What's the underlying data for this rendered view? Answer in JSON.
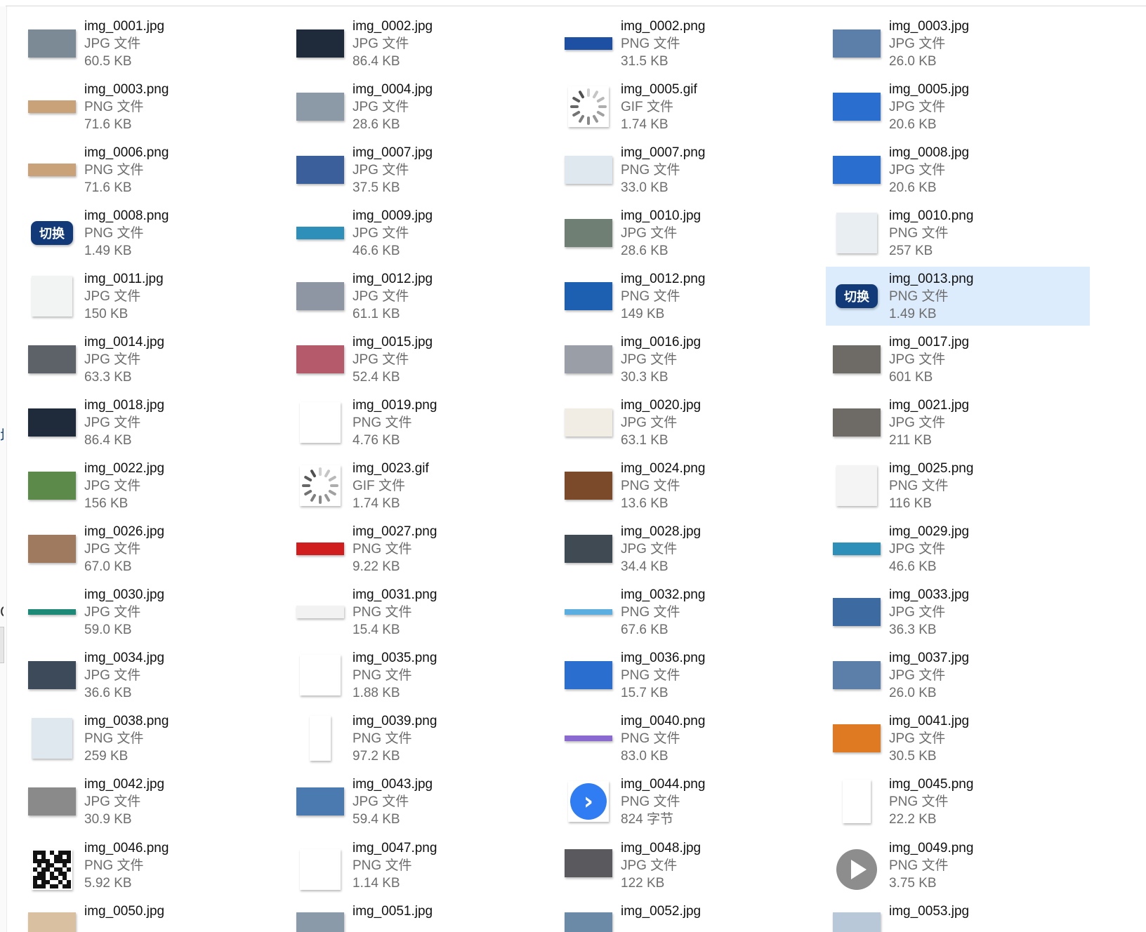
{
  "files": [
    {
      "name": "img_0001.jpg",
      "type": "JPG 文件",
      "size": "60.5 KB",
      "thumb": {
        "kind": "photo",
        "bg": "#7c8a96"
      }
    },
    {
      "name": "img_0002.jpg",
      "type": "JPG 文件",
      "size": "86.4 KB",
      "thumb": {
        "kind": "photo",
        "bg": "#1f2a3a"
      }
    },
    {
      "name": "img_0002.png",
      "type": "PNG 文件",
      "size": "31.5 KB",
      "thumb": {
        "kind": "banner",
        "bg": "#1d4fa3"
      }
    },
    {
      "name": "img_0003.jpg",
      "type": "JPG 文件",
      "size": "26.0 KB",
      "thumb": {
        "kind": "photo",
        "bg": "#5b7fa8"
      }
    },
    {
      "name": "img_0003.png",
      "type": "PNG 文件",
      "size": "71.6 KB",
      "thumb": {
        "kind": "banner",
        "bg": "#c9a27a"
      }
    },
    {
      "name": "img_0004.jpg",
      "type": "JPG 文件",
      "size": "28.6 KB",
      "thumb": {
        "kind": "photo",
        "bg": "#8c9aa8"
      }
    },
    {
      "name": "img_0005.gif",
      "type": "GIF 文件",
      "size": "1.74 KB",
      "thumb": {
        "kind": "spinner",
        "bg": "#ffffff"
      }
    },
    {
      "name": "img_0005.jpg",
      "type": "JPG 文件",
      "size": "20.6 KB",
      "thumb": {
        "kind": "photo",
        "bg": "#2a6fd0"
      }
    },
    {
      "name": "img_0006.png",
      "type": "PNG 文件",
      "size": "71.6 KB",
      "thumb": {
        "kind": "banner",
        "bg": "#c9a27a"
      }
    },
    {
      "name": "img_0007.jpg",
      "type": "JPG 文件",
      "size": "37.5 KB",
      "thumb": {
        "kind": "photo",
        "bg": "#3b5f9a"
      }
    },
    {
      "name": "img_0007.png",
      "type": "PNG 文件",
      "size": "33.0 KB",
      "thumb": {
        "kind": "photo",
        "bg": "#dfe8ef"
      }
    },
    {
      "name": "img_0008.jpg",
      "type": "JPG 文件",
      "size": "20.6 KB",
      "thumb": {
        "kind": "photo",
        "bg": "#2a6fd0"
      }
    },
    {
      "name": "img_0008.png",
      "type": "PNG 文件",
      "size": "1.49 KB",
      "thumb": {
        "kind": "badge",
        "bg": "#123a78",
        "text": "切换"
      }
    },
    {
      "name": "img_0009.jpg",
      "type": "JPG 文件",
      "size": "46.6 KB",
      "thumb": {
        "kind": "banner",
        "bg": "#2e8fb8"
      }
    },
    {
      "name": "img_0010.jpg",
      "type": "JPG 文件",
      "size": "28.6 KB",
      "thumb": {
        "kind": "photo",
        "bg": "#6f7f73"
      }
    },
    {
      "name": "img_0010.png",
      "type": "PNG 文件",
      "size": "257 KB",
      "thumb": {
        "kind": "square",
        "bg": "#e9eef3"
      }
    },
    {
      "name": "img_0011.jpg",
      "type": "JPG 文件",
      "size": "150 KB",
      "thumb": {
        "kind": "square",
        "bg": "#f1f4f2"
      }
    },
    {
      "name": "img_0012.jpg",
      "type": "JPG 文件",
      "size": "61.1 KB",
      "thumb": {
        "kind": "photo",
        "bg": "#8e96a4"
      }
    },
    {
      "name": "img_0012.png",
      "type": "PNG 文件",
      "size": "149 KB",
      "thumb": {
        "kind": "photo",
        "bg": "#1d5fb0"
      }
    },
    {
      "name": "img_0013.png",
      "type": "PNG 文件",
      "size": "1.49 KB",
      "thumb": {
        "kind": "badge",
        "bg": "#123a78",
        "text": "切换"
      },
      "selected": true
    },
    {
      "name": "img_0014.jpg",
      "type": "JPG 文件",
      "size": "63.3 KB",
      "thumb": {
        "kind": "photo",
        "bg": "#5d6268"
      }
    },
    {
      "name": "img_0015.jpg",
      "type": "JPG 文件",
      "size": "52.4 KB",
      "thumb": {
        "kind": "photo",
        "bg": "#b45a6a"
      }
    },
    {
      "name": "img_0016.jpg",
      "type": "JPG 文件",
      "size": "30.3 KB",
      "thumb": {
        "kind": "photo",
        "bg": "#9a9ea6"
      }
    },
    {
      "name": "img_0017.jpg",
      "type": "JPG 文件",
      "size": "601 KB",
      "thumb": {
        "kind": "photo",
        "bg": "#6e6a66"
      }
    },
    {
      "name": "img_0018.jpg",
      "type": "JPG 文件",
      "size": "86.4 KB",
      "thumb": {
        "kind": "photo",
        "bg": "#1f2a3a"
      }
    },
    {
      "name": "img_0019.png",
      "type": "PNG 文件",
      "size": "4.76 KB",
      "thumb": {
        "kind": "square",
        "bg": "#ffffff"
      }
    },
    {
      "name": "img_0020.jpg",
      "type": "JPG 文件",
      "size": "63.1 KB",
      "thumb": {
        "kind": "photo",
        "bg": "#f1ece4"
      }
    },
    {
      "name": "img_0021.jpg",
      "type": "JPG 文件",
      "size": "211 KB",
      "thumb": {
        "kind": "photo",
        "bg": "#6e6a66"
      }
    },
    {
      "name": "img_0022.jpg",
      "type": "JPG 文件",
      "size": "156 KB",
      "thumb": {
        "kind": "photo",
        "bg": "#5c8a4a"
      }
    },
    {
      "name": "img_0023.gif",
      "type": "GIF 文件",
      "size": "1.74 KB",
      "thumb": {
        "kind": "spinner",
        "bg": "#ffffff"
      }
    },
    {
      "name": "img_0024.png",
      "type": "PNG 文件",
      "size": "13.6 KB",
      "thumb": {
        "kind": "photo",
        "bg": "#7a4a2a"
      }
    },
    {
      "name": "img_0025.png",
      "type": "PNG 文件",
      "size": "116 KB",
      "thumb": {
        "kind": "square",
        "bg": "#f4f4f4"
      }
    },
    {
      "name": "img_0026.jpg",
      "type": "JPG 文件",
      "size": "67.0 KB",
      "thumb": {
        "kind": "photo",
        "bg": "#a07a5e"
      }
    },
    {
      "name": "img_0027.png",
      "type": "PNG 文件",
      "size": "9.22 KB",
      "thumb": {
        "kind": "banner",
        "bg": "#d01e1e"
      }
    },
    {
      "name": "img_0028.jpg",
      "type": "JPG 文件",
      "size": "34.4 KB",
      "thumb": {
        "kind": "photo",
        "bg": "#3f4a52"
      }
    },
    {
      "name": "img_0029.jpg",
      "type": "JPG 文件",
      "size": "46.6 KB",
      "thumb": {
        "kind": "banner",
        "bg": "#2e8fb8"
      }
    },
    {
      "name": "img_0030.jpg",
      "type": "JPG 文件",
      "size": "59.0 KB",
      "thumb": {
        "kind": "thin",
        "bg": "#1d8a78"
      }
    },
    {
      "name": "img_0031.png",
      "type": "PNG 文件",
      "size": "15.4 KB",
      "thumb": {
        "kind": "banner",
        "bg": "#f2f2f2"
      }
    },
    {
      "name": "img_0032.png",
      "type": "PNG 文件",
      "size": "67.6 KB",
      "thumb": {
        "kind": "thin",
        "bg": "#5aaee0"
      }
    },
    {
      "name": "img_0033.jpg",
      "type": "JPG 文件",
      "size": "36.3 KB",
      "thumb": {
        "kind": "photo",
        "bg": "#3e6aa2"
      }
    },
    {
      "name": "img_0034.jpg",
      "type": "JPG 文件",
      "size": "36.6 KB",
      "thumb": {
        "kind": "photo",
        "bg": "#3d4a5a"
      }
    },
    {
      "name": "img_0035.png",
      "type": "PNG 文件",
      "size": "1.88 KB",
      "thumb": {
        "kind": "square",
        "bg": "#ffffff"
      }
    },
    {
      "name": "img_0036.png",
      "type": "PNG 文件",
      "size": "15.7 KB",
      "thumb": {
        "kind": "photo",
        "bg": "#2a6fd0"
      }
    },
    {
      "name": "img_0037.jpg",
      "type": "JPG 文件",
      "size": "26.0 KB",
      "thumb": {
        "kind": "photo",
        "bg": "#5b7fa8"
      }
    },
    {
      "name": "img_0038.png",
      "type": "PNG 文件",
      "size": "259 KB",
      "thumb": {
        "kind": "square",
        "bg": "#dfe8ef"
      }
    },
    {
      "name": "img_0039.png",
      "type": "PNG 文件",
      "size": "97.2 KB",
      "thumb": {
        "kind": "tall",
        "bg": "#ffffff"
      }
    },
    {
      "name": "img_0040.png",
      "type": "PNG 文件",
      "size": "83.0 KB",
      "thumb": {
        "kind": "thin",
        "bg": "#8a6ad0"
      }
    },
    {
      "name": "img_0041.jpg",
      "type": "JPG 文件",
      "size": "30.5 KB",
      "thumb": {
        "kind": "photo",
        "bg": "#e07a22"
      }
    },
    {
      "name": "img_0042.jpg",
      "type": "JPG 文件",
      "size": "30.9 KB",
      "thumb": {
        "kind": "photo",
        "bg": "#8a8a8a"
      }
    },
    {
      "name": "img_0043.jpg",
      "type": "JPG 文件",
      "size": "59.4 KB",
      "thumb": {
        "kind": "photo",
        "bg": "#4a7ab0"
      }
    },
    {
      "name": "img_0044.png",
      "type": "PNG 文件",
      "size": "824 字节",
      "thumb": {
        "kind": "arrow",
        "bg": "#ffffff"
      }
    },
    {
      "name": "img_0045.png",
      "type": "PNG 文件",
      "size": "22.2 KB",
      "thumb": {
        "kind": "portrait",
        "bg": "#ffffff"
      }
    },
    {
      "name": "img_0046.png",
      "type": "PNG 文件",
      "size": "5.92 KB",
      "thumb": {
        "kind": "qr",
        "bg": "#ffffff"
      }
    },
    {
      "name": "img_0047.png",
      "type": "PNG 文件",
      "size": "1.14 KB",
      "thumb": {
        "kind": "square",
        "bg": "#ffffff"
      }
    },
    {
      "name": "img_0048.jpg",
      "type": "JPG 文件",
      "size": "122 KB",
      "thumb": {
        "kind": "photo",
        "bg": "#5a5a5e"
      }
    },
    {
      "name": "img_0049.png",
      "type": "PNG 文件",
      "size": "3.75 KB",
      "thumb": {
        "kind": "play",
        "bg": "#ffffff"
      }
    },
    {
      "name": "img_0050.jpg",
      "type": "",
      "size": "",
      "thumb": {
        "kind": "photo",
        "bg": "#d8c0a0"
      }
    },
    {
      "name": "img_0051.jpg",
      "type": "",
      "size": "",
      "thumb": {
        "kind": "photo",
        "bg": "#8a9aa8"
      }
    },
    {
      "name": "img_0052.jpg",
      "type": "",
      "size": "",
      "thumb": {
        "kind": "photo",
        "bg": "#6a8aa8"
      }
    },
    {
      "name": "img_0053.jpg",
      "type": "",
      "size": "",
      "thumb": {
        "kind": "photo",
        "bg": "#b8c8d8"
      }
    }
  ],
  "selection_color": "#dcecfc",
  "gutter": {
    "mark1": "城",
    "mark2": "C"
  }
}
